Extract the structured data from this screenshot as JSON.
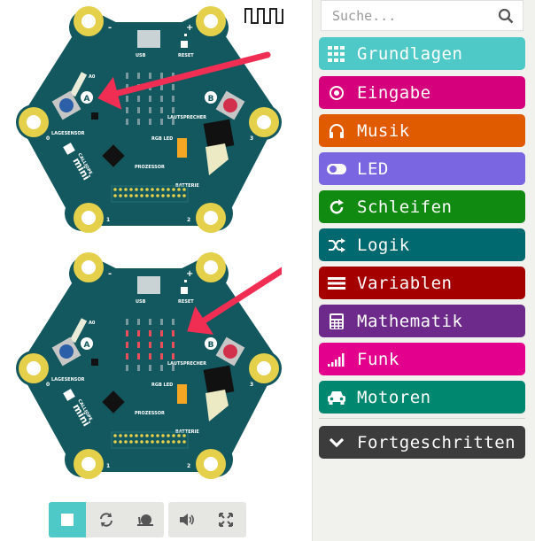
{
  "search": {
    "placeholder": "Suche..."
  },
  "categories": [
    {
      "label": "Grundlagen",
      "color": "#4ec9c7",
      "icon": "grid-icon"
    },
    {
      "label": "Eingabe",
      "color": "#d4007c",
      "icon": "target-icon"
    },
    {
      "label": "Musik",
      "color": "#e05a00",
      "icon": "headphones-icon"
    },
    {
      "label": "LED",
      "color": "#7a66e0",
      "icon": "toggle-icon"
    },
    {
      "label": "Schleifen",
      "color": "#108a10",
      "icon": "refresh-icon"
    },
    {
      "label": "Logik",
      "color": "#006970",
      "icon": "shuffle-icon"
    },
    {
      "label": "Variablen",
      "color": "#a50000",
      "icon": "list-icon"
    },
    {
      "label": "Mathematik",
      "color": "#6d2a8a",
      "icon": "calculator-icon"
    },
    {
      "label": "Funk",
      "color": "#e3008c",
      "icon": "signal-icon"
    },
    {
      "label": "Motoren",
      "color": "#00876f",
      "icon": "car-icon"
    },
    {
      "label": "Fortgeschritten",
      "color": "#3c3c3c",
      "icon": "chevron-down-icon"
    }
  ],
  "board": {
    "pcb_color": "#13585f",
    "pad_color": "#e4d04a",
    "labels": {
      "usb": "USB",
      "reset": "RESET",
      "a0": "A0",
      "btn_a": "A",
      "btn_b": "B",
      "lagesensor": "LAGESENSOR",
      "lautsprecher": "LAUTSPRECHER",
      "rgb_led": "RGB LED",
      "prozessor": "PROZESSOR",
      "batterie": "BATTERIE",
      "brand_top": "CALLIOPE",
      "brand_bottom": "mini",
      "pin_minus": "-",
      "pin_plus": "+",
      "pin_1": "1",
      "pin_2": "2",
      "pin_3": "3",
      "pin_0": "0"
    }
  },
  "bottom_board": {
    "lit_leds": [
      [
        0,
        2
      ],
      [
        1,
        2
      ],
      [
        2,
        2
      ],
      [
        3,
        2
      ],
      [
        4,
        2
      ],
      [
        0,
        3
      ],
      [
        1,
        3
      ],
      [
        2,
        3
      ],
      [
        3,
        3
      ],
      [
        4,
        3
      ],
      [
        0,
        1
      ],
      [
        1,
        1
      ],
      [
        2,
        1
      ],
      [
        3,
        1
      ],
      [
        4,
        1
      ]
    ]
  },
  "arrow_color": "#f02e54",
  "controls": {
    "stop": "stop-icon",
    "restart": "restart-icon",
    "slow": "snail-icon",
    "mute": "speaker-icon",
    "fullscreen": "fullscreen-icon"
  }
}
